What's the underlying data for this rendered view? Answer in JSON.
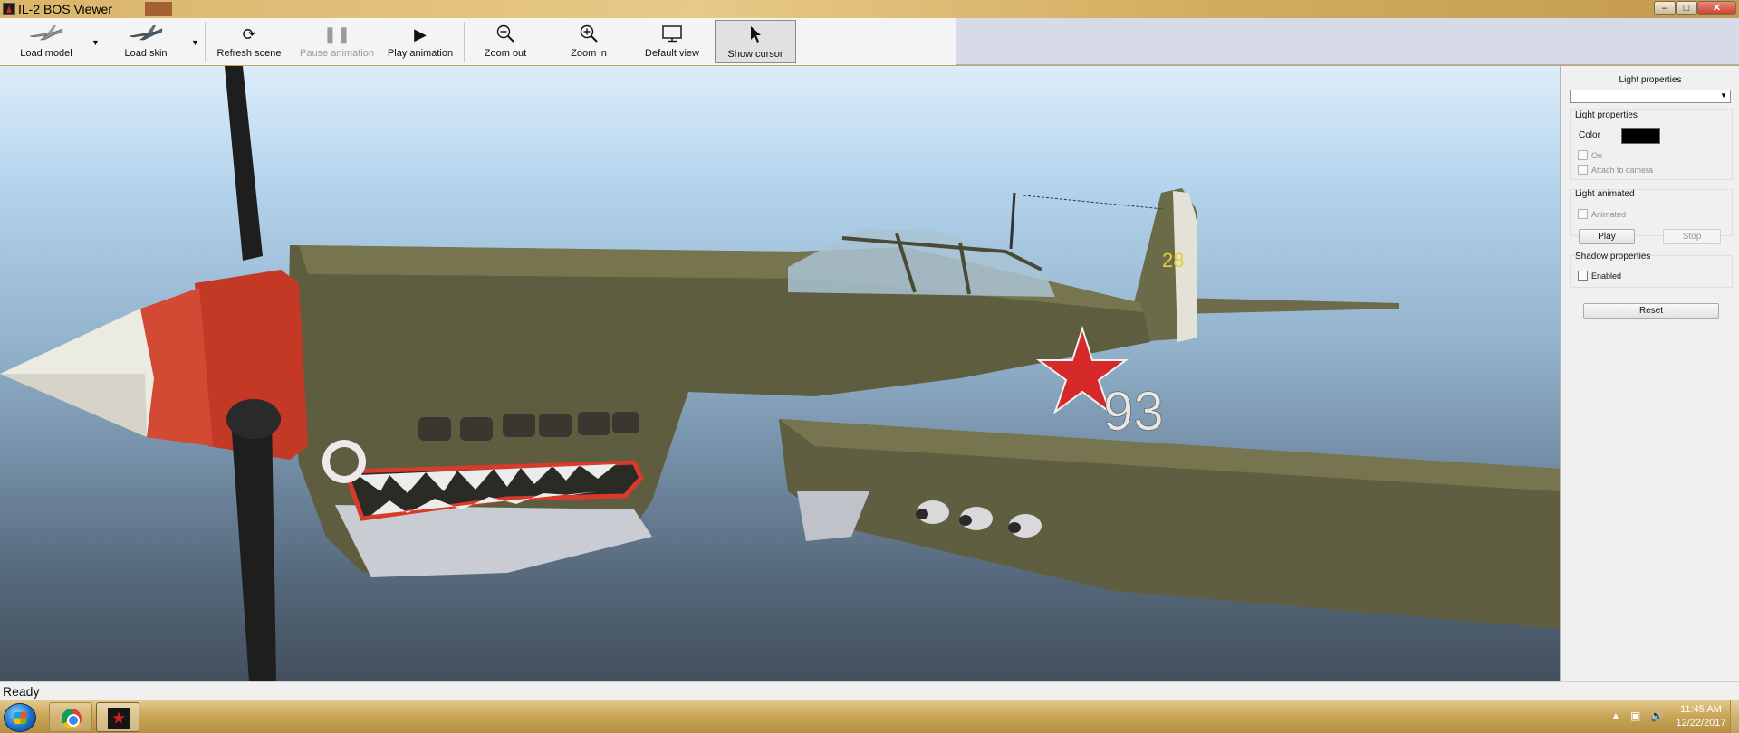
{
  "window": {
    "title": "IL-2 BOS Viewer"
  },
  "toolbar": {
    "load_model": "Load model",
    "load_skin": "Load skin",
    "refresh_scene": "Refresh scene",
    "pause_animation": "Pause animation",
    "play_animation": "Play animation",
    "zoom_out": "Zoom out",
    "zoom_in": "Zoom in",
    "default_view": "Default view",
    "show_cursor": "Show cursor"
  },
  "viewport": {
    "aircraft_number": "93",
    "tail_number": "28"
  },
  "panel": {
    "header": "Light properties",
    "light_group_title": "Light properties",
    "color_label": "Color",
    "color_value": "#000000",
    "on_label": "On",
    "attach_label": "Attach to camera",
    "animated_group_title": "Light animated",
    "animated_label": "Animated",
    "play_label": "Play",
    "stop_label": "Stop",
    "shadow_group_title": "Shadow properties",
    "enabled_label": "Enabled",
    "reset_label": "Reset"
  },
  "status": {
    "text": "Ready"
  },
  "taskbar": {
    "time": "11:45 AM",
    "date": "12/22/2017"
  },
  "icons": {
    "load_model": "plane-icon",
    "load_skin": "plane-skin-icon",
    "refresh": "refresh-icon",
    "pause": "pause-icon",
    "play": "play-icon",
    "zoom_out": "zoom-out-icon",
    "zoom_in": "zoom-in-icon",
    "default_view": "monitor-icon",
    "show_cursor": "cursor-icon"
  }
}
